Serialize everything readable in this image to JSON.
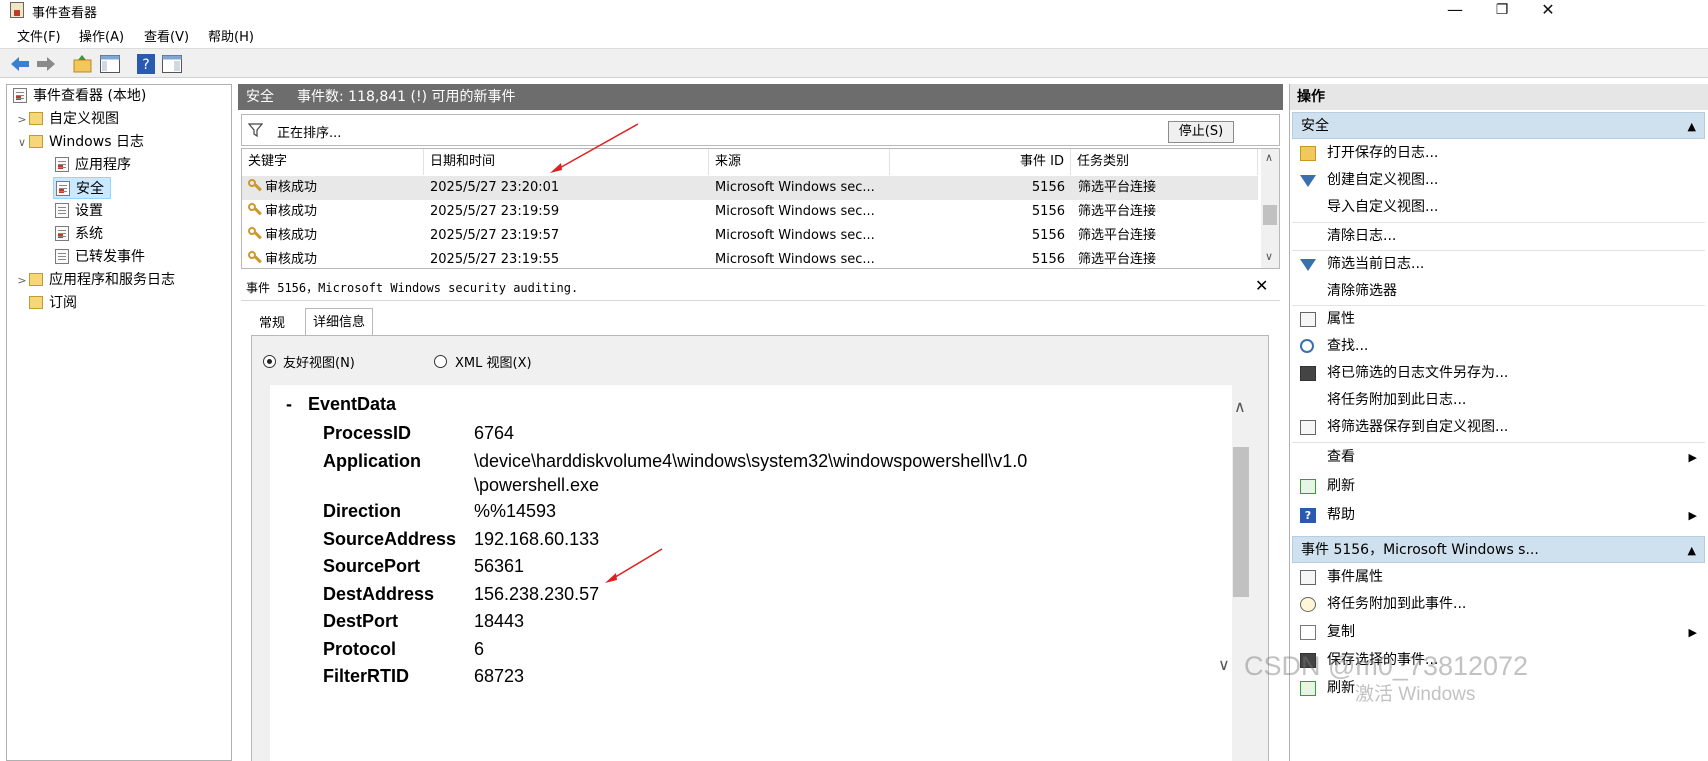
{
  "window": {
    "title": "事件查看器",
    "controls": {
      "minimize": "—",
      "maximize": "❐",
      "close": "✕"
    }
  },
  "menubar": [
    "文件(F)",
    "操作(A)",
    "查看(V)",
    "帮助(H)"
  ],
  "tree": {
    "root": "事件查看器 (本地)",
    "custom_views": "自定义视图",
    "windows_logs": "Windows 日志",
    "logs": [
      "应用程序",
      "安全",
      "设置",
      "系统",
      "已转发事件"
    ],
    "app_service_logs": "应用程序和服务日志",
    "subscriptions": "订阅"
  },
  "center": {
    "log_name": "安全",
    "event_count": "事件数: 118,841 (!) 可用的新事件",
    "filter_status": "正在排序...",
    "stop_button": "停止(S)",
    "columns": [
      "关键字",
      "日期和时间",
      "来源",
      "事件 ID",
      "任务类别"
    ],
    "rows": [
      {
        "keyword": "审核成功",
        "datetime": "2025/5/27 23:20:01",
        "source": "Microsoft Windows sec...",
        "event_id": "5156",
        "category": "筛选平台连接"
      },
      {
        "keyword": "审核成功",
        "datetime": "2025/5/27 23:19:59",
        "source": "Microsoft Windows sec...",
        "event_id": "5156",
        "category": "筛选平台连接"
      },
      {
        "keyword": "审核成功",
        "datetime": "2025/5/27 23:19:57",
        "source": "Microsoft Windows sec...",
        "event_id": "5156",
        "category": "筛选平台连接"
      },
      {
        "keyword": "审核成功",
        "datetime": "2025/5/27 23:19:55",
        "source": "Microsoft Windows sec...",
        "event_id": "5156",
        "category": "筛选平台连接"
      }
    ]
  },
  "detail": {
    "title": "事件 5156，Microsoft Windows security auditing.",
    "tabs": [
      "常规",
      "详细信息"
    ],
    "view_friendly": "友好视图(N)",
    "view_xml": "XML 视图(X)",
    "section_toggle": "-",
    "section": "EventData",
    "fields": [
      {
        "key": "ProcessID",
        "value": "6764"
      },
      {
        "key": "Application",
        "value": "\\device\\harddiskvolume4\\windows\\system32\\windowspowershell\\v1.0",
        "value2": "\\powershell.exe"
      },
      {
        "key": "Direction",
        "value": "%%14593"
      },
      {
        "key": "SourceAddress",
        "value": "192.168.60.133"
      },
      {
        "key": "SourcePort",
        "value": "56361"
      },
      {
        "key": "DestAddress",
        "value": "156.238.230.57"
      },
      {
        "key": "DestPort",
        "value": "18443"
      },
      {
        "key": "Protocol",
        "value": "6"
      },
      {
        "key": "FilterRTID",
        "value": "68723"
      }
    ]
  },
  "actions": {
    "title": "操作",
    "section1": "安全",
    "items1": [
      "打开保存的日志...",
      "创建自定义视图...",
      "导入自定义视图...",
      "清除日志...",
      "筛选当前日志...",
      "清除筛选器",
      "属性",
      "查找...",
      "将已筛选的日志文件另存为...",
      "将任务附加到此日志...",
      "将筛选器保存到自定义视图...",
      "查看",
      "刷新",
      "帮助"
    ],
    "section2": "事件 5156，Microsoft Windows s...",
    "items2": [
      "事件属性",
      "将任务附加到此事件...",
      "复制",
      "保存选择的事件...",
      "刷新"
    ]
  },
  "watermark": {
    "main": "CSDN @m0_73812072",
    "sub": "激活 Windows"
  },
  "colors": {
    "selection": "#cce8ff",
    "header_gray": "#6d6d6d",
    "section_blue": "#cfe0ef",
    "annotation_red": "#e02020"
  }
}
